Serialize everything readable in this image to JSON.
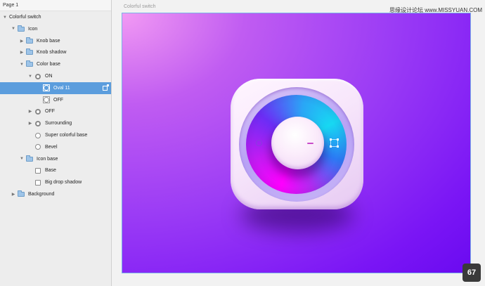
{
  "app": {
    "page_title": "Page 1",
    "artboard_label": "Colorful switch",
    "watermark": "思缘设计论坛 www.MISSYUAN.COM",
    "zoom_badge": "67"
  },
  "layers": [
    {
      "label": "Colorful switch",
      "indent": 0,
      "icon": "none",
      "expander": "expanded",
      "selected": false
    },
    {
      "label": "Icon",
      "indent": 1,
      "icon": "folder-icon",
      "expander": "expanded",
      "selected": false
    },
    {
      "label": "Knob base",
      "indent": 2,
      "icon": "folder-icon",
      "expander": "collapsed",
      "selected": false
    },
    {
      "label": "Knob shadow",
      "indent": 2,
      "icon": "folder-icon",
      "expander": "collapsed",
      "selected": false
    },
    {
      "label": "Color base",
      "indent": 2,
      "icon": "folder-icon",
      "expander": "expanded",
      "selected": false
    },
    {
      "label": "ON",
      "indent": 3,
      "icon": "oval-group-icon",
      "expander": "expanded",
      "selected": false
    },
    {
      "label": "Oval 11",
      "indent": 4,
      "icon": "oval-thumb-icon",
      "expander": "none",
      "selected": true
    },
    {
      "label": "OFF",
      "indent": 4,
      "icon": "oval-thumb-icon",
      "expander": "none",
      "selected": false
    },
    {
      "label": "OFF",
      "indent": 3,
      "icon": "oval-group-icon",
      "expander": "collapsed",
      "selected": false
    },
    {
      "label": "Surrounding",
      "indent": 3,
      "icon": "oval-group-icon",
      "expander": "collapsed",
      "selected": false
    },
    {
      "label": "Super colorful base",
      "indent": 3,
      "icon": "oval-icon",
      "expander": "none",
      "selected": false
    },
    {
      "label": "Bevel",
      "indent": 3,
      "icon": "oval-icon",
      "expander": "none",
      "selected": false
    },
    {
      "label": "Icon base",
      "indent": 2,
      "icon": "folder-icon",
      "expander": "expanded",
      "selected": false
    },
    {
      "label": "Base",
      "indent": 3,
      "icon": "rect-icon",
      "expander": "none",
      "selected": false
    },
    {
      "label": "Big drop shadow",
      "indent": 3,
      "icon": "rect-icon",
      "expander": "none",
      "selected": false
    },
    {
      "label": "Background",
      "indent": 1,
      "icon": "folder-icon",
      "expander": "collapsed",
      "selected": false
    }
  ],
  "colors": {
    "selection": "#5b9ddd",
    "background_start": "#f29af3",
    "background_end": "#6a0af0",
    "ring_magenta": "#ff00ff",
    "ring_cyan": "#17d8f2"
  }
}
